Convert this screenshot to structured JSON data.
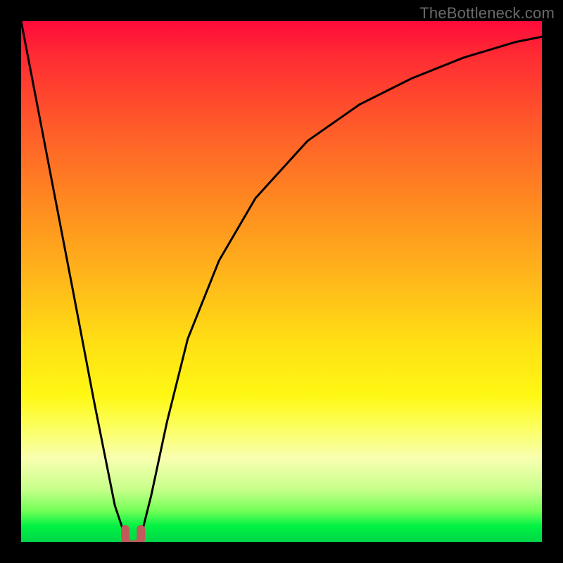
{
  "watermark": "TheBottleneck.com",
  "chart_data": {
    "type": "line",
    "title": "",
    "xlabel": "",
    "ylabel": "",
    "xlim": [
      0,
      100
    ],
    "ylim": [
      0,
      100
    ],
    "series": [
      {
        "name": "bottleneck-curve",
        "x": [
          0,
          5,
          10,
          14,
          18,
          20,
          21,
          22,
          23,
          25,
          28,
          32,
          38,
          45,
          55,
          65,
          75,
          85,
          95,
          100
        ],
        "values": [
          100,
          74,
          48,
          27,
          7,
          1,
          0,
          0,
          1,
          9,
          23,
          39,
          54,
          66,
          77,
          84,
          89,
          93,
          96,
          97
        ]
      }
    ],
    "marker": {
      "name": "optimal-range",
      "x_range": [
        20,
        23
      ],
      "y": 0,
      "color": "#c15a5a"
    }
  }
}
